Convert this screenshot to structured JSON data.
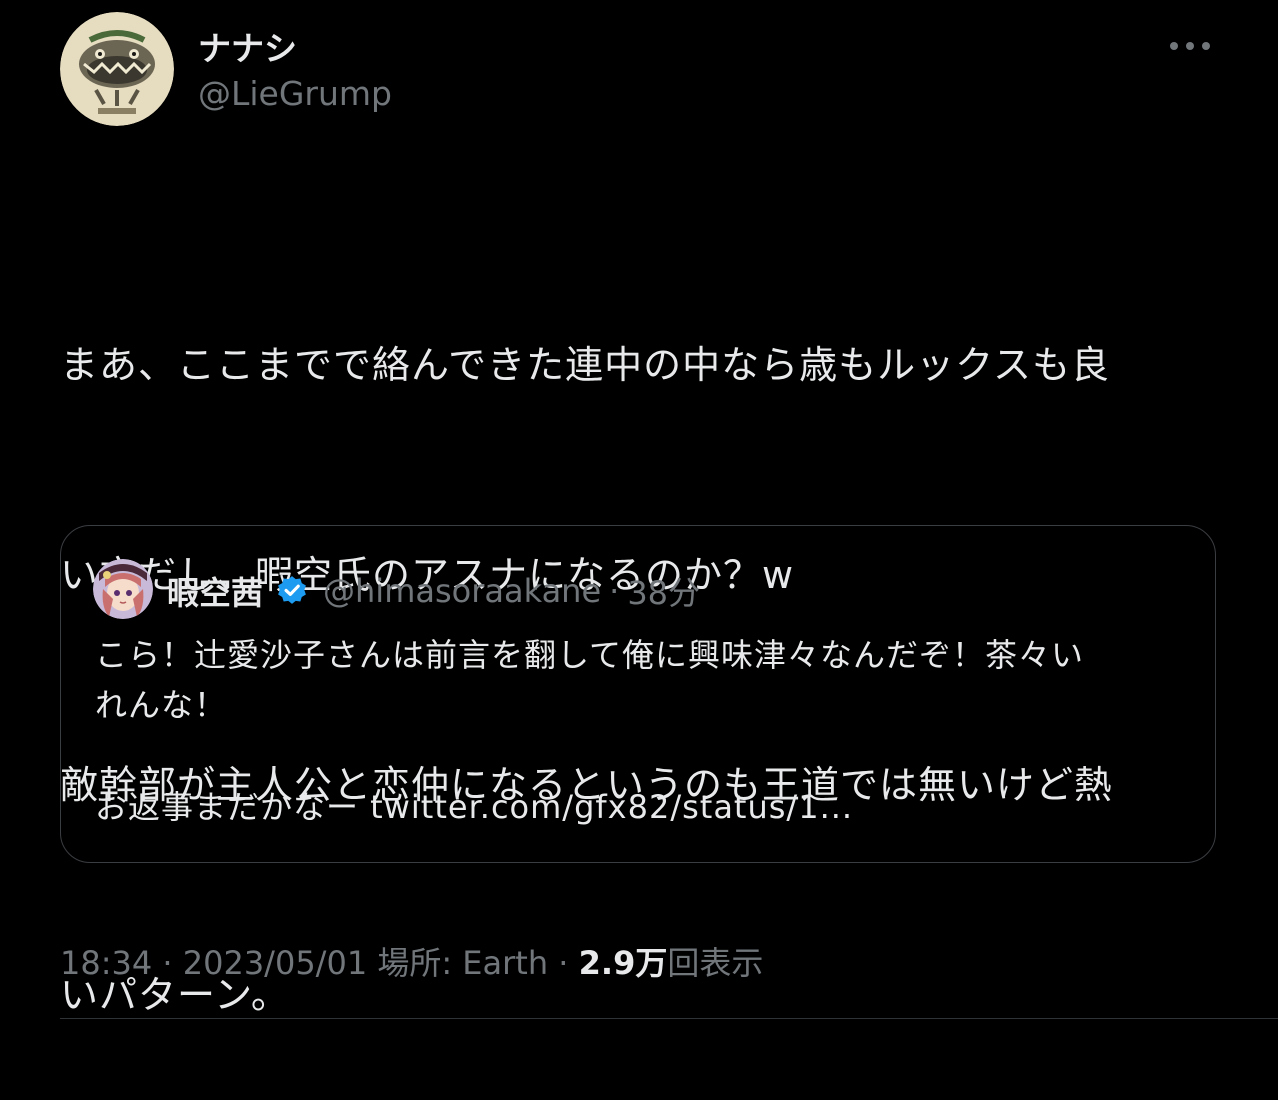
{
  "author": {
    "display_name": "ナナシ",
    "handle": "@LieGrump",
    "avatar_icon": "creature-illustration-avatar-icon"
  },
  "tweet": {
    "lines": [
      "まあ、ここまでで絡んできた連中の中なら歳もルックスも良",
      "い方だし、暇空氏のアスナになるのか？w",
      "敵幹部が主人公と恋仲になるというのも王道では無いけど熱",
      "いパターン。"
    ]
  },
  "quote": {
    "display_name": "暇空茜",
    "verified_icon": "verified-badge-icon",
    "handle": "@himasoraakane",
    "separator": "·",
    "time": "38分",
    "avatar_icon": "anime-character-avatar-icon",
    "body_lines": [
      "こら！辻愛沙子さんは前言を翻して俺に興味津々なんだぞ！茶々い",
      "れんな！"
    ],
    "footer_text": "お返事まだかなー twitter.com/gfx82/status/1..."
  },
  "meta": {
    "time": "18:34",
    "sep1": "·",
    "date": "2023/05/01",
    "location": "場所: Earth",
    "sep2": "·",
    "views_count": "2.9万",
    "views_label": "回表示"
  },
  "colors": {
    "background": "#000000",
    "text_primary": "#e7e9ea",
    "text_secondary": "#71767b",
    "border": "#3a3d41",
    "verified_blue": "#1d9bf0"
  }
}
